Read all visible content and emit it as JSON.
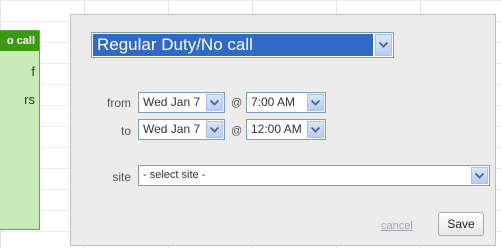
{
  "calendar": {
    "event_header": "o call",
    "event_lines": [
      "f",
      "rs"
    ]
  },
  "dialog": {
    "title_select": {
      "value": "Regular Duty/No call"
    },
    "from": {
      "label": "from",
      "date": "Wed Jan 7",
      "at": "@",
      "time": "7:00 AM"
    },
    "to": {
      "label": "to",
      "date": "Wed Jan 7",
      "at": "@",
      "time": "12:00 AM"
    },
    "site": {
      "label": "site",
      "value": "- select site -"
    },
    "actions": {
      "cancel_label": "cancel",
      "save_label": "Save"
    }
  },
  "colors": {
    "event_green": "#3a9a14",
    "event_bg": "#c9ebb8",
    "selection_blue": "#3169c6",
    "dropdown_button": "#b7cdf6"
  },
  "icons": {
    "dropdown": "chevron-down-icon"
  }
}
